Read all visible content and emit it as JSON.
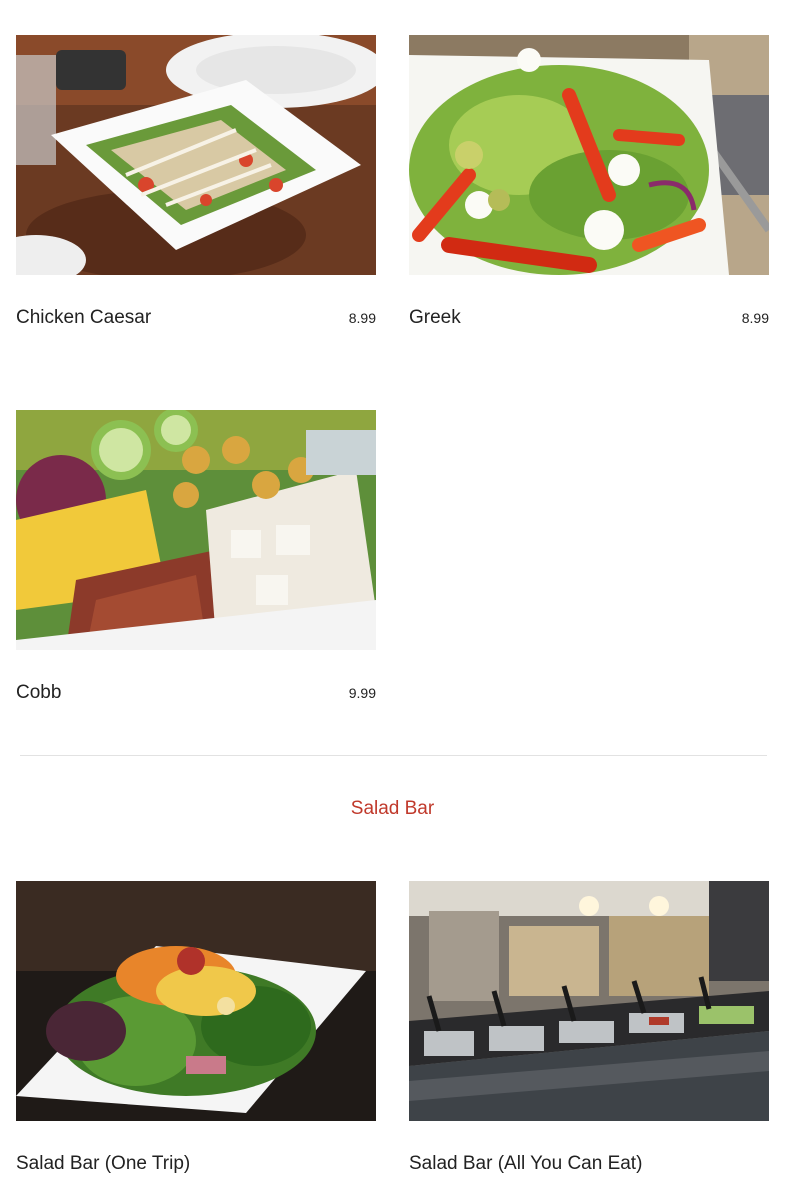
{
  "menu": {
    "salads": [
      {
        "name": "Chicken Caesar",
        "price": "8.99",
        "photo": "chicken-caesar-photo"
      },
      {
        "name": "Greek",
        "price": "8.99",
        "photo": "greek-salad-photo"
      },
      {
        "name": "Cobb",
        "price": "9.99",
        "photo": "cobb-salad-photo"
      }
    ],
    "salad_bar_section": {
      "title": "Salad Bar",
      "items": [
        {
          "name": "Salad Bar (One Trip)",
          "photo": "salad-plate-photo"
        },
        {
          "name": "Salad Bar (All You Can Eat)",
          "photo": "salad-bar-counter-photo"
        }
      ]
    }
  },
  "colors": {
    "section_title": "#c0392b",
    "divider": "#e2e2e2"
  }
}
